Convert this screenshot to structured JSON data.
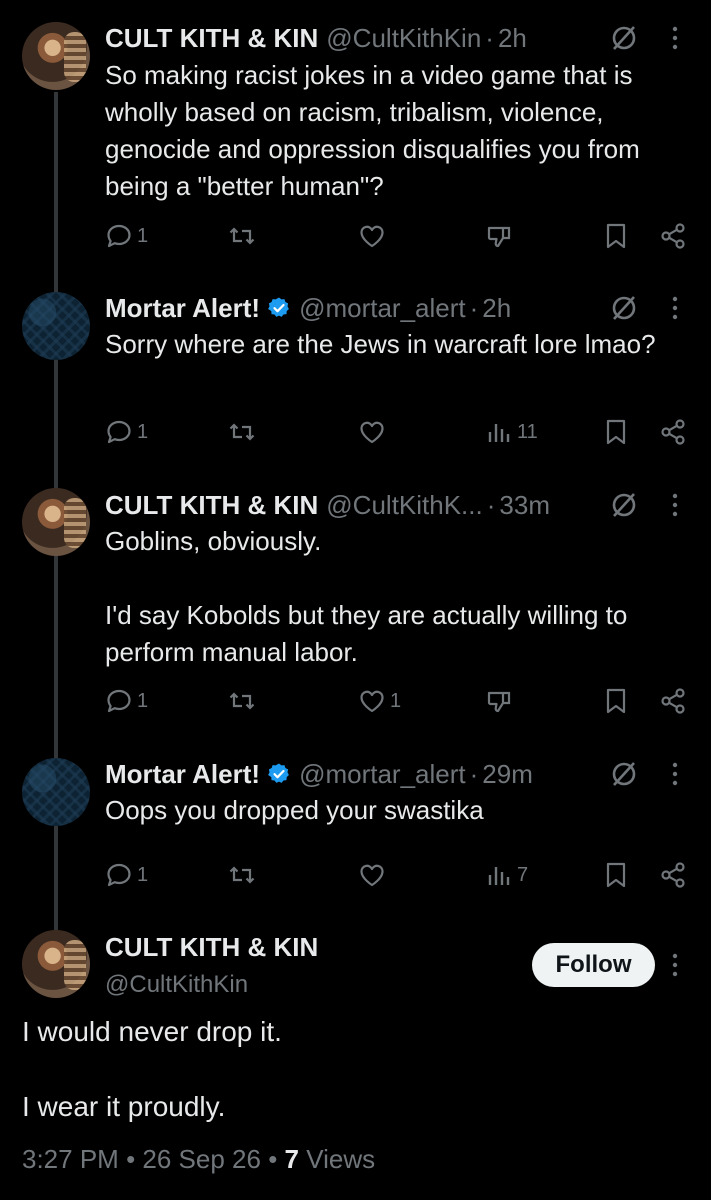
{
  "tweets": [
    {
      "name": "CULT KITH & KIN",
      "handle": "@CultKithKin",
      "time": "2h",
      "text": "So making racist jokes in a video game that is wholly based on racism, tribalism, violence, genocide and oppression disqualifies you from being a \"better human\"?",
      "replies": "1",
      "likes": "",
      "avatar": "cult-avatar",
      "verified": false
    },
    {
      "name": "Mortar Alert!",
      "handle": "@mortar_alert",
      "time": "2h",
      "text": "Sorry where are the Jews in warcraft lore lmao?",
      "replies": "1",
      "likes": "",
      "views": "11",
      "avatar": "mortar-avatar",
      "verified": true
    },
    {
      "name": "CULT KITH & KIN",
      "handle": "@CultKithK...",
      "time": "33m",
      "text": "Goblins, obviously.\n\nI'd say Kobolds but they are actually willing to perform manual labor.",
      "replies": "1",
      "likes": "1",
      "avatar": "cult-avatar",
      "verified": false
    },
    {
      "name": "Mortar Alert!",
      "handle": "@mortar_alert",
      "time": "29m",
      "text": "Oops you dropped your swastika",
      "replies": "1",
      "likes": "",
      "views": "7",
      "avatar": "mortar-avatar",
      "verified": true
    }
  ],
  "separator": "·",
  "focus": {
    "name": "CULT KITH & KIN",
    "handle": "@CultKithKin",
    "follow_label": "Follow",
    "line1": "I would never drop it.",
    "line2": "I wear it proudly.",
    "time": "3:27 PM",
    "bullet": "•",
    "date": "26 Sep 26",
    "views_count": "7",
    "views_label": "Views"
  },
  "colors": {
    "background": "#000000",
    "text": "#e7e9ea",
    "muted": "#71767b",
    "verified_blue": "#1d9bf0",
    "thread_line": "#333639"
  }
}
